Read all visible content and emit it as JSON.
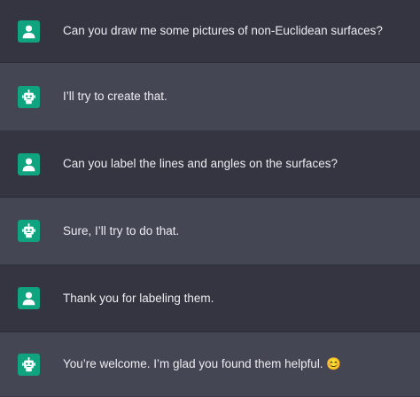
{
  "theme": {
    "user_row_bg": "#343541",
    "assistant_row_bg": "#444654",
    "avatar_bg": "#10a37f",
    "text_color": "#ececf1"
  },
  "messages": [
    {
      "role": "user",
      "avatar_icon": "user-icon",
      "text": "Can you draw me some pictures of non-Euclidean surfaces?"
    },
    {
      "role": "assistant",
      "avatar_icon": "robot-icon",
      "text": "I’ll try to create that."
    },
    {
      "role": "user",
      "avatar_icon": "user-icon",
      "text": "Can you label the lines and angles on the surfaces?"
    },
    {
      "role": "assistant",
      "avatar_icon": "robot-icon",
      "text": "Sure, I’ll try to do that."
    },
    {
      "role": "user",
      "avatar_icon": "user-icon",
      "text": "Thank you for labeling them."
    },
    {
      "role": "assistant",
      "avatar_icon": "robot-icon",
      "text": "You’re welcome. I’m glad you found them helpful. 😊"
    }
  ]
}
